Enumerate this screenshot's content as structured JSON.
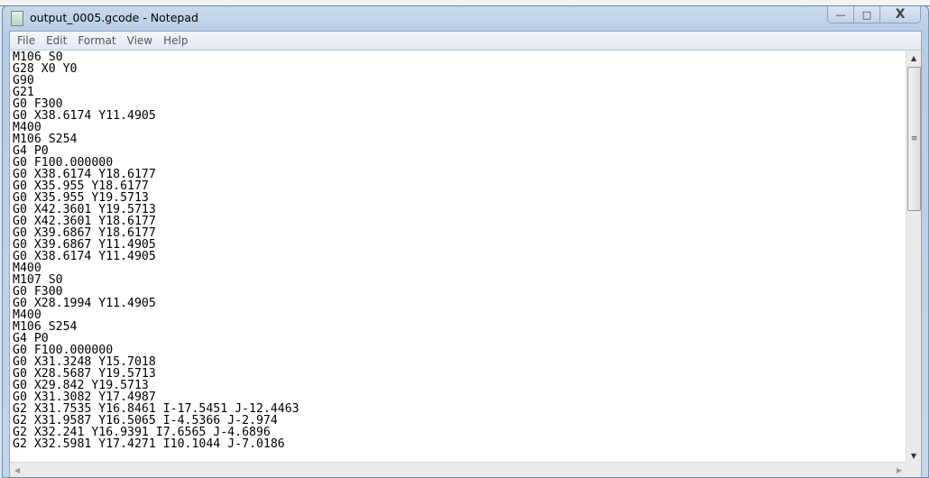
{
  "window": {
    "title": "output_0005.gcode - Notepad"
  },
  "caption": {
    "minimize": "—",
    "maximize": "□",
    "close": "X"
  },
  "menu": [
    "File",
    "Edit",
    "Format",
    "View",
    "Help"
  ],
  "lines": [
    "M106 S0",
    "G28 X0 Y0",
    "G90",
    "G21",
    "G0 F300",
    "G0 X38.6174 Y11.4905",
    "M400",
    "M106 S254",
    "G4 P0",
    "G0 F100.000000",
    "G0 X38.6174 Y18.6177",
    "G0 X35.955 Y18.6177",
    "G0 X35.955 Y19.5713",
    "G0 X42.3601 Y19.5713",
    "G0 X42.3601 Y18.6177",
    "G0 X39.6867 Y18.6177",
    "G0 X39.6867 Y11.4905",
    "G0 X38.6174 Y11.4905",
    "M400",
    "M107 S0",
    "G0 F300",
    "G0 X28.1994 Y11.4905",
    "M400",
    "M106 S254",
    "G4 P0",
    "G0 F100.000000",
    "G0 X31.3248 Y15.7018",
    "G0 X28.5687 Y19.5713",
    "G0 X29.842 Y19.5713",
    "G0 X31.3082 Y17.4987",
    "G2 X31.7535 Y16.8461 I-17.5451 J-12.4463",
    "G2 X31.9587 Y16.5065 I-4.5366 J-2.974",
    "G2 X32.241 Y16.9391 I7.6565 J-4.6896",
    "G2 X32.5981 Y17.4271 I10.1044 J-7.0186"
  ]
}
